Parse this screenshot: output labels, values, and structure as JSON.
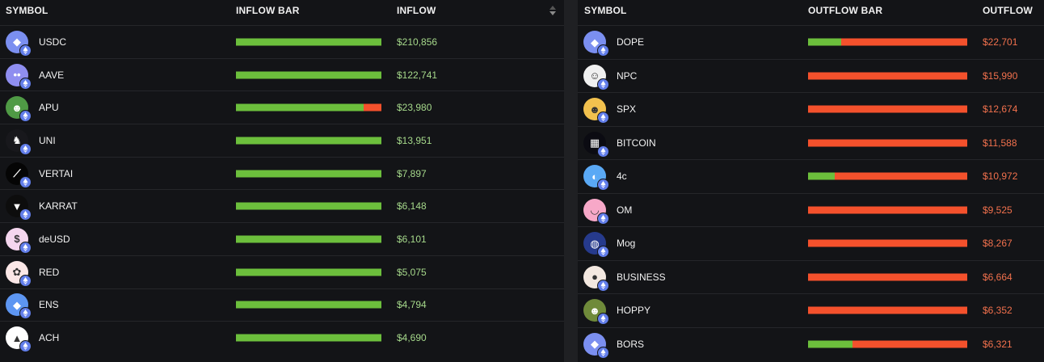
{
  "colors": {
    "inflow_bar": "#6cbf3c",
    "outflow_bar": "#f4512c",
    "inflow_text": "#a6d98b",
    "outflow_text": "#f2714d",
    "chain_badge": "#627eea"
  },
  "inflow_table": {
    "headers": {
      "symbol": "SYMBOL",
      "bar": "INFLOW BAR",
      "value": "INFLOW"
    },
    "sorted_column": "INFLOW",
    "sort_direction": "descending",
    "rows": [
      {
        "symbol": "USDC",
        "value": "$210,856",
        "inflow_fraction": 1.0,
        "icon": "usdc-token-icon",
        "icon_bg": "#7b8ff0",
        "icon_glyph": "◆"
      },
      {
        "symbol": "AAVE",
        "value": "$122,741",
        "inflow_fraction": 1.0,
        "icon": "aave-token-icon",
        "icon_bg": "#8f8ef0",
        "icon_glyph": "••"
      },
      {
        "symbol": "APU",
        "value": "$23,980",
        "inflow_fraction": 0.88,
        "icon": "apu-token-icon",
        "icon_bg": "#4f9a45",
        "icon_glyph": "☻"
      },
      {
        "symbol": "UNI",
        "value": "$13,951",
        "inflow_fraction": 1.0,
        "icon": "uni-token-icon",
        "icon_bg": "#18181c",
        "icon_glyph": "♞"
      },
      {
        "symbol": "VERTAI",
        "value": "$7,897",
        "inflow_fraction": 1.0,
        "icon": "vertai-token-icon",
        "icon_bg": "#050505",
        "icon_glyph": "⟋"
      },
      {
        "symbol": "KARRAT",
        "value": "$6,148",
        "inflow_fraction": 1.0,
        "icon": "karrat-token-icon",
        "icon_bg": "#0d0d0d",
        "icon_glyph": "▼"
      },
      {
        "symbol": "deUSD",
        "value": "$6,101",
        "inflow_fraction": 1.0,
        "icon": "deusd-token-icon",
        "icon_bg": "#f4d6ee",
        "icon_glyph": "$"
      },
      {
        "symbol": "RED",
        "value": "$5,075",
        "inflow_fraction": 1.0,
        "icon": "red-token-icon",
        "icon_bg": "#fbe7e7",
        "icon_glyph": "✿"
      },
      {
        "symbol": "ENS",
        "value": "$4,794",
        "inflow_fraction": 1.0,
        "icon": "ens-token-icon",
        "icon_bg": "#5d96f2",
        "icon_glyph": "◆"
      },
      {
        "symbol": "ACH",
        "value": "$4,690",
        "inflow_fraction": 1.0,
        "icon": "ach-token-icon",
        "icon_bg": "#ffffff",
        "icon_glyph": "▲"
      }
    ]
  },
  "outflow_table": {
    "headers": {
      "symbol": "SYMBOL",
      "bar": "OUTFLOW BAR",
      "value": "OUTFLOW"
    },
    "rows": [
      {
        "symbol": "DOPE",
        "value": "$22,701",
        "inflow_fraction": 0.21,
        "icon": "dope-token-icon",
        "icon_bg": "#7b8ff0",
        "icon_glyph": "◆"
      },
      {
        "symbol": "NPC",
        "value": "$15,990",
        "inflow_fraction": 0.0,
        "icon": "npc-token-icon",
        "icon_bg": "#f0f0f0",
        "icon_glyph": "☺"
      },
      {
        "symbol": "SPX",
        "value": "$12,674",
        "inflow_fraction": 0.0,
        "icon": "spx-token-icon",
        "icon_bg": "#f2c14e",
        "icon_glyph": "☻"
      },
      {
        "symbol": "BITCOIN",
        "value": "$11,588",
        "inflow_fraction": 0.0,
        "icon": "bitcoin-token-icon",
        "icon_bg": "#0b0b12",
        "icon_glyph": "▦"
      },
      {
        "symbol": "4c",
        "value": "$10,972",
        "inflow_fraction": 0.17,
        "icon": "4c-token-icon",
        "icon_bg": "#5aa9f5",
        "icon_glyph": "◐"
      },
      {
        "symbol": "OM",
        "value": "$9,525",
        "inflow_fraction": 0.0,
        "icon": "om-token-icon",
        "icon_bg": "#f7a8c8",
        "icon_glyph": "◡"
      },
      {
        "symbol": "Mog",
        "value": "$8,267",
        "inflow_fraction": 0.0,
        "icon": "mog-token-icon",
        "icon_bg": "#263a8c",
        "icon_glyph": "◍"
      },
      {
        "symbol": "BUSINESS",
        "value": "$6,664",
        "inflow_fraction": 0.0,
        "icon": "business-token-icon",
        "icon_bg": "#f3e8e0",
        "icon_glyph": "●"
      },
      {
        "symbol": "HOPPY",
        "value": "$6,352",
        "inflow_fraction": 0.0,
        "icon": "hoppy-token-icon",
        "icon_bg": "#6f8a3a",
        "icon_glyph": "☻"
      },
      {
        "symbol": "BORS",
        "value": "$6,321",
        "inflow_fraction": 0.28,
        "icon": "bors-token-icon",
        "icon_bg": "#7b8ff0",
        "icon_glyph": "◆"
      }
    ]
  }
}
